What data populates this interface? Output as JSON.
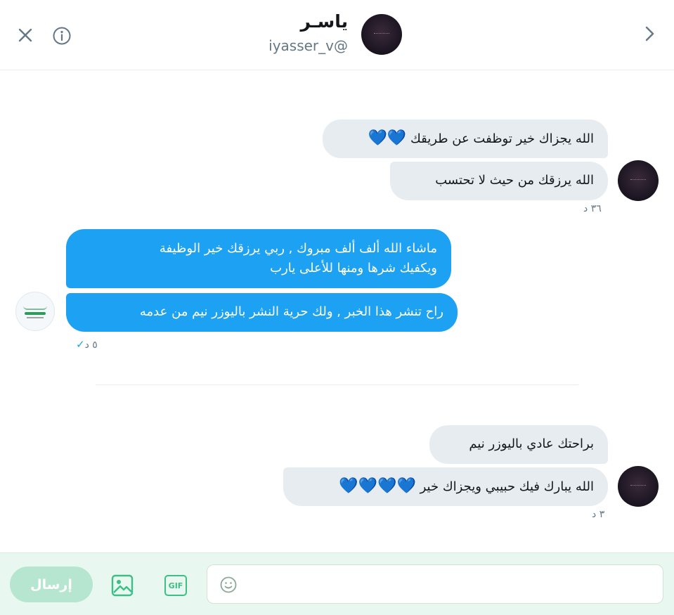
{
  "header": {
    "name": "ياسـر",
    "handle": "iyasser_v@"
  },
  "messages": {
    "m1": {
      "text": "الله يجزاك خير توظفت عن طريقك",
      "hearts": "💙💙"
    },
    "m2": {
      "text": "الله يرزقك من حيث لا تحتسب"
    },
    "ts1": "٣٦ د",
    "m3": {
      "line1": "ماشاء الله ألف ألف مبروك , ربي يرزقك خير الوظيفة",
      "line2": "ويكفيك شرها ومنها للأعلى يارب"
    },
    "m4": {
      "text": "راح تنشر هذا الخبر , ولك حرية النشر باليوزر نيم من عدمه"
    },
    "ts2": "٥ د",
    "ts2_check": "✓",
    "m5": {
      "text": "براحتك عادي باليوزر نيم"
    },
    "m6": {
      "text": "الله يبارك فيك حبيبي ويجزاك خير",
      "hearts": "💙💙💙💙"
    },
    "ts3": "٣ د"
  },
  "composer": {
    "send_label": "إرسال",
    "input_value": "",
    "gif_label": "GIF"
  },
  "colors": {
    "blue_bubble": "#1da1f2",
    "gray_bubble": "#e6ecf0",
    "composer_bg": "#e8f7f0",
    "send_disabled": "#b6e6cf",
    "tool_green": "#3cbf84"
  },
  "icons": {
    "close": "close-icon",
    "info": "info-icon",
    "back": "chevron-right-icon",
    "image": "image-icon",
    "gif": "gif-icon",
    "emoji": "emoji-icon"
  }
}
